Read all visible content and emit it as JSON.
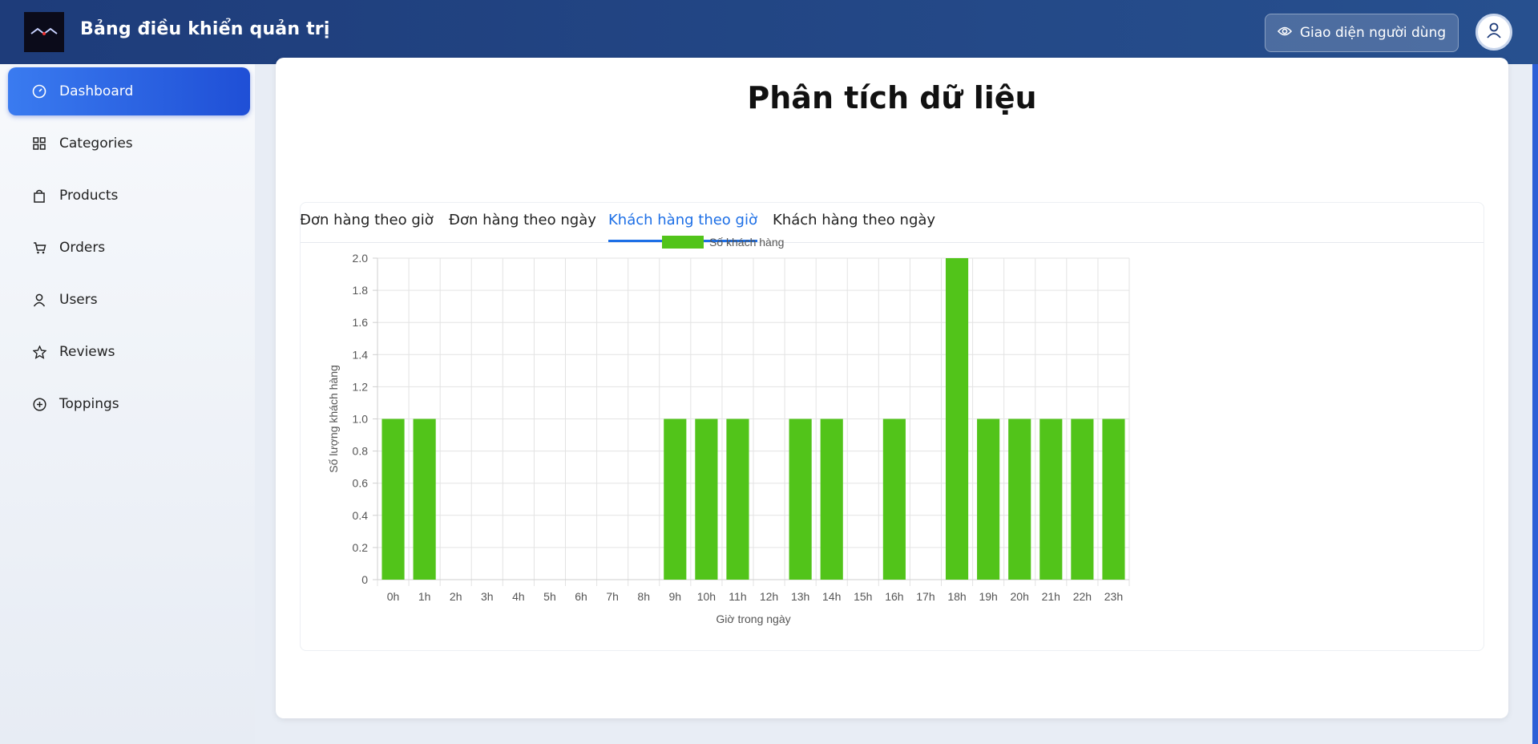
{
  "header": {
    "title": "Bảng điều khiển quản trị",
    "user_view_label": "Giao diện người dùng"
  },
  "sidebar": {
    "items": [
      {
        "label": "Dashboard",
        "icon": "dashboard-icon",
        "active": true
      },
      {
        "label": "Categories",
        "icon": "grid-icon"
      },
      {
        "label": "Products",
        "icon": "bag-icon"
      },
      {
        "label": "Orders",
        "icon": "cart-icon"
      },
      {
        "label": "Users",
        "icon": "user-icon"
      },
      {
        "label": "Reviews",
        "icon": "star-icon"
      },
      {
        "label": "Toppings",
        "icon": "plus-circle-icon"
      }
    ]
  },
  "main": {
    "title": "Phân tích dữ liệu",
    "tabs": [
      {
        "label": "Đơn hàng theo giờ"
      },
      {
        "label": "Đơn hàng theo ngày"
      },
      {
        "label": "Khách hàng theo giờ",
        "active": true
      },
      {
        "label": "Khách hàng theo ngày"
      }
    ]
  },
  "colors": {
    "accent": "#1d6fe6",
    "bar": "#52c41a",
    "header": "#1e3c7a"
  },
  "chart_data": {
    "type": "bar",
    "categories": [
      "0h",
      "1h",
      "2h",
      "3h",
      "4h",
      "5h",
      "6h",
      "7h",
      "8h",
      "9h",
      "10h",
      "11h",
      "12h",
      "13h",
      "14h",
      "15h",
      "16h",
      "17h",
      "18h",
      "19h",
      "20h",
      "21h",
      "22h",
      "23h"
    ],
    "series": [
      {
        "name": "Số khách hàng",
        "values": [
          1,
          1,
          0,
          0,
          0,
          0,
          0,
          0,
          0,
          1,
          1,
          1,
          0,
          1,
          1,
          0,
          1,
          0,
          2,
          1,
          1,
          1,
          1,
          1
        ]
      }
    ],
    "xlabel": "Giờ trong ngày",
    "ylabel": "Số lượng khách hàng",
    "ylim": [
      0,
      2
    ],
    "yticks": [
      "0",
      "0.2",
      "0.4",
      "0.6",
      "0.8",
      "1.0",
      "1.2",
      "1.4",
      "1.6",
      "1.8",
      "2.0"
    ],
    "grid": true,
    "legend": "top-center"
  }
}
